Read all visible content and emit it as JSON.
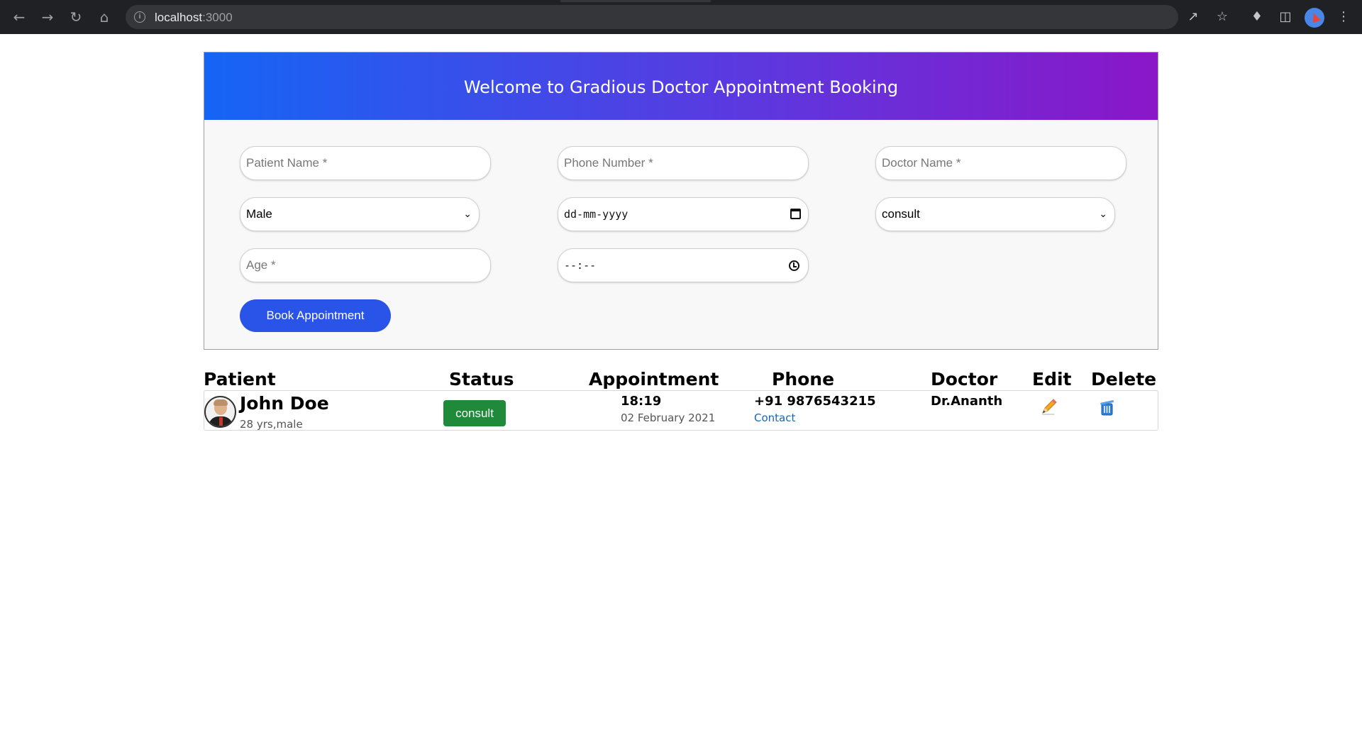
{
  "browser": {
    "url_host": "localhost",
    "url_port": ":3000"
  },
  "banner": {
    "title": "Welcome to Gradious Doctor Appointment Booking"
  },
  "form": {
    "patient_name_placeholder": "Patient Name *",
    "phone_placeholder": "Phone Number *",
    "doctor_placeholder": "Doctor Name *",
    "gender_value": "Male",
    "date_value": "dd-mm-yyyy",
    "status_value": "consult",
    "age_placeholder": "Age *",
    "time_value": "--:--",
    "book_label": "Book Appointment"
  },
  "table": {
    "headers": [
      "Patient",
      "Status",
      "Appointment",
      "Phone",
      "Doctor",
      "Edit",
      "Delete"
    ],
    "rows": [
      {
        "name": "John Doe",
        "sub": "28 yrs,male",
        "status": "consult",
        "time": "18:19",
        "date": "02 February 2021",
        "phone": "+91 9876543215",
        "contact": "Contact",
        "doctor": "Dr.Ananth"
      }
    ]
  },
  "colors": {
    "banner_start": "#1565f5",
    "banner_end": "#8a17c8",
    "book_button": "#2a53e8",
    "status_badge": "#1e8a3a",
    "link": "#1565c0"
  }
}
